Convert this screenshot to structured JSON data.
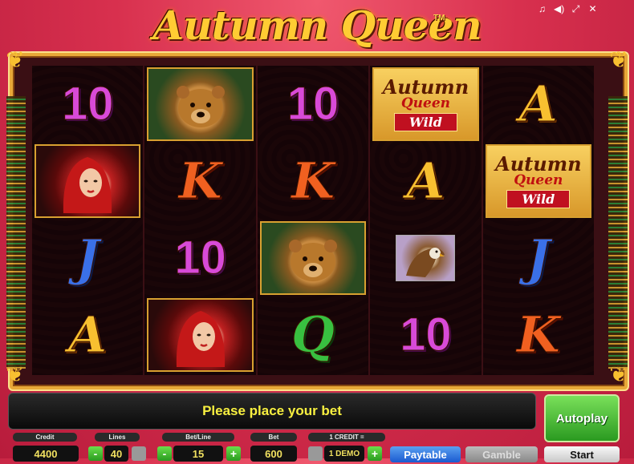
{
  "game": {
    "title": "Autumn Queen",
    "trademark": "TM"
  },
  "top_icons": [
    "music-note-icon",
    "speaker-icon",
    "fullscreen-icon",
    "close-icon"
  ],
  "reels": [
    [
      {
        "type": "letter",
        "symbol": "10",
        "cls": "l10"
      },
      {
        "type": "woman",
        "symbol": "red-haired-queen"
      },
      {
        "type": "letter",
        "symbol": "J",
        "cls": "lJ"
      },
      {
        "type": "letter",
        "symbol": "A",
        "cls": "lA"
      }
    ],
    [
      {
        "type": "bear",
        "symbol": "bear"
      },
      {
        "type": "letter",
        "symbol": "K",
        "cls": "lK"
      },
      {
        "type": "letter",
        "symbol": "10",
        "cls": "l10"
      },
      {
        "type": "woman",
        "symbol": "red-haired-queen"
      }
    ],
    [
      {
        "type": "letter",
        "symbol": "10",
        "cls": "l10"
      },
      {
        "type": "letter",
        "symbol": "K",
        "cls": "lK"
      },
      {
        "type": "bear",
        "symbol": "bear"
      },
      {
        "type": "letter",
        "symbol": "Q",
        "cls": "lQ"
      }
    ],
    [
      {
        "type": "wild",
        "symbol": "wild",
        "line1": "Autumn",
        "line2": "Queen",
        "line3": "Wild"
      },
      {
        "type": "letter",
        "symbol": "A",
        "cls": "lA"
      },
      {
        "type": "eagle",
        "symbol": "eagle"
      },
      {
        "type": "letter",
        "symbol": "10",
        "cls": "l10"
      }
    ],
    [
      {
        "type": "letter",
        "symbol": "A",
        "cls": "lA"
      },
      {
        "type": "wild",
        "symbol": "wild",
        "line1": "Autumn",
        "line2": "Queen",
        "line3": "Wild"
      },
      {
        "type": "letter",
        "symbol": "J",
        "cls": "lJ"
      },
      {
        "type": "letter",
        "symbol": "K",
        "cls": "lK"
      }
    ]
  ],
  "message": "Please place your bet",
  "buttons": {
    "autoplay": "Autoplay",
    "paytable": "Paytable",
    "gamble": "Gamble",
    "start": "Start",
    "plus": "+",
    "minus": "-"
  },
  "labels": {
    "credit": "Credit",
    "lines": "Lines",
    "bet_line": "Bet/Line",
    "bet": "Bet",
    "credit_rate": "1 CREDIT ="
  },
  "values": {
    "credit": "4400",
    "lines": "40",
    "bet_line": "15",
    "bet": "600",
    "credit_rate": "1 DEMO"
  }
}
